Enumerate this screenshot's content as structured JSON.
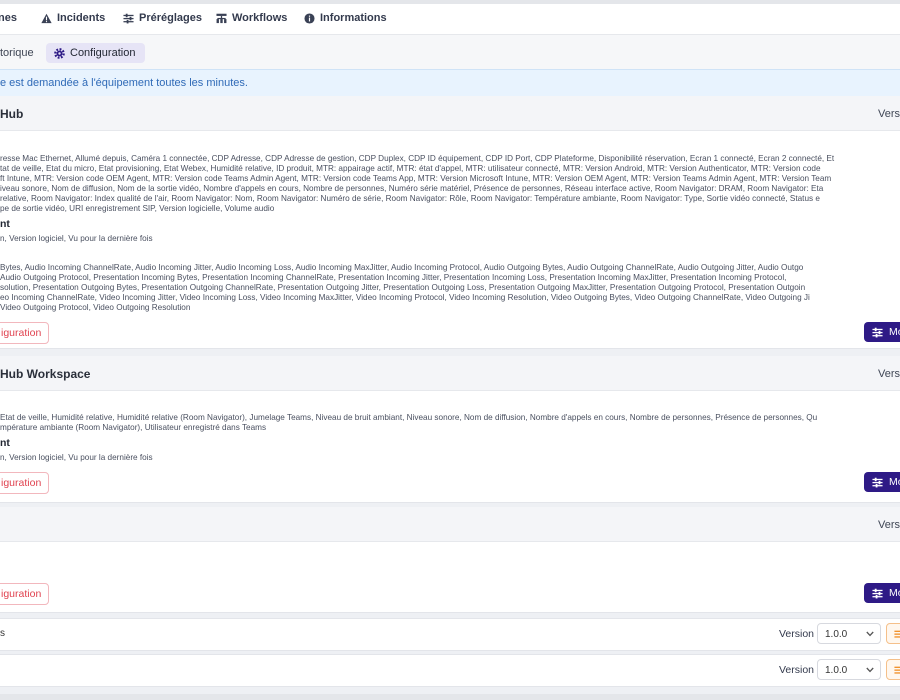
{
  "nav": [
    {
      "label": "nes",
      "icon": "none"
    },
    {
      "label": "Incidents",
      "icon": "warning-icon"
    },
    {
      "label": "Préréglages",
      "icon": "sliders-icon"
    },
    {
      "label": "Workflows",
      "icon": "workflow-icon"
    },
    {
      "label": "Informations",
      "icon": "info-icon"
    }
  ],
  "subtabs": {
    "history": "torique",
    "config": "Configuration"
  },
  "info_banner": "e est demandée à l'équipement toutes les minutes.",
  "cards": [
    {
      "title": "Hub",
      "version_label": "Vers",
      "attributes": [
        "resse Mac Ethernet, Allumé depuis, Caméra 1 connectée, CDP Adresse, CDP Adresse de gestion, CDP Duplex, CDP ID équipement, CDP ID Port, CDP Plateforme, Disponibilité réservation, Ecran 1 connecté, Ecran 2 connecté, Et",
        "tat de veille, Etat du micro, Etat provisioning, Etat Webex, Humidité relative, ID produit, MTR: appairage actif, MTR: état d'appel, MTR: utilisateur connecté, MTR: Version Android, MTR: Version Authenticator, MTR: Version code",
        "ft Intune, MTR: Version code OEM Agent, MTR: Version code Teams Admin Agent, MTR: Version code Teams App, MTR: Version Microsoft Intune, MTR: Version OEM Agent, MTR: Version Teams Admin Agent, MTR: Version Team",
        "iveau sonore, Nom de diffusion, Nom de la sortie vidéo, Nombre d'appels en cours, Nombre de personnes, Numéro série matériel, Présence de personnes, Réseau interface active, Room Navigator: DRAM, Room Navigator: Eta",
        "relative, Room Navigator: Index qualité de l'air, Room Navigator: Nom, Room Navigator: Numéro de série, Room Navigator: Rôle, Room Navigator: Température ambiante, Room Navigator: Type, Sortie vidéo connecté, Status e",
        "pe de sortie vidéo, URI enregistrement SIP, Version logicielle, Volume audio"
      ],
      "section_title": "nt",
      "section_text": "n, Version logiciel, Vu pour la dernière fois",
      "metrics": [
        "Bytes, Audio Incoming ChannelRate, Audio Incoming Jitter, Audio Incoming Loss, Audio Incoming MaxJitter, Audio Incoming Protocol, Audio Outgoing Bytes, Audio Outgoing ChannelRate, Audio Outgoing Jitter, Audio Outgo",
        "Audio Outgoing Protocol, Presentation Incoming Bytes, Presentation Incoming ChannelRate, Presentation Incoming Jitter, Presentation Incoming Loss, Presentation Incoming MaxJitter, Presentation Incoming Protocol,",
        "solution, Presentation Outgoing Bytes, Presentation Outgoing ChannelRate, Presentation Outgoing Jitter, Presentation Outgoing Loss, Presentation Outgoing MaxJitter, Presentation Outgoing Protocol, Presentation Outgoin",
        "eo Incoming ChannelRate, Video Incoming Jitter, Video Incoming Loss, Video Incoming MaxJitter, Video Incoming Protocol, Video Incoming Resolution, Video Outgoing Bytes, Video Outgoing ChannelRate, Video Outgoing Ji",
        "Video Outgoing Protocol, Video Outgoing Resolution"
      ],
      "config_label": "iguration",
      "modify_label": "Mo"
    },
    {
      "title": "Hub Workspace",
      "version_label": "Vers",
      "attributes": [
        "Etat de veille, Humidité relative, Humidité relative (Room Navigator), Jumelage Teams, Niveau de bruit ambiant, Niveau sonore, Nom de diffusion, Nombre d'appels en cours, Nombre de personnes, Présence de personnes, Qu",
        "mpérature ambiante (Room Navigator), Utilisateur enregistré dans Teams"
      ],
      "section_title": "nt",
      "section_text": "n, Version logiciel, Vu pour la dernière fois",
      "config_label": "iguration",
      "modify_label": "Mo"
    },
    {
      "title": "",
      "version_label": "Vers",
      "config_label": "iguration",
      "modify_label": "Mo"
    }
  ],
  "rows": [
    {
      "left": "s",
      "version_label": "Version",
      "version_value": "1.0.0"
    },
    {
      "left": "",
      "version_label": "Version",
      "version_value": "1.0.0"
    }
  ]
}
